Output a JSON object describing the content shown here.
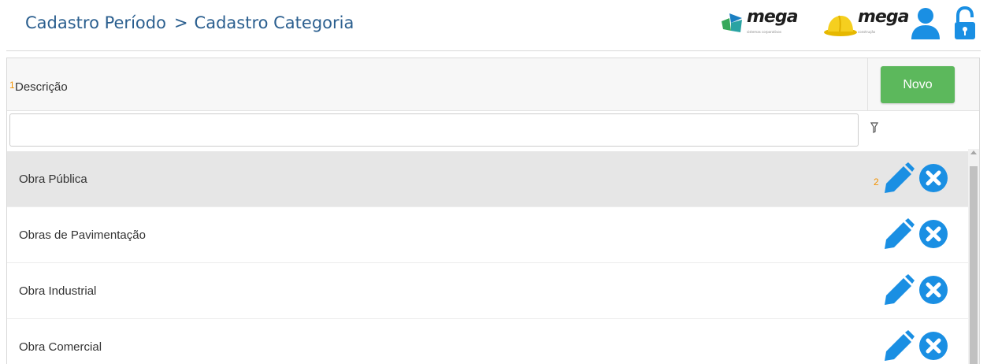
{
  "breadcrumb": {
    "items": [
      "Cadastro Período",
      "Cadastro Categoria"
    ],
    "separator": ">"
  },
  "header": {
    "logos": [
      {
        "name": "mega",
        "sub": "sistemas corporativos",
        "icon": "mega-logo-icon"
      },
      {
        "name": "mega",
        "sub": "construção",
        "icon": "construction-helmet-icon"
      }
    ],
    "icons": [
      "user-icon",
      "lock-icon"
    ],
    "accent": "#2b5f8f",
    "icon_color": "#1a8fe3"
  },
  "table": {
    "header_marker": "1",
    "column_label": "Descrição",
    "new_button": "Novo",
    "new_button_color": "#5cb85c",
    "filter": {
      "value": "",
      "placeholder": ""
    },
    "row_marker": "2",
    "rows": [
      {
        "description": "Obra Pública"
      },
      {
        "description": "Obras de Pavimentação"
      },
      {
        "description": "Obra Industrial"
      },
      {
        "description": "Obra Comercial"
      }
    ]
  }
}
